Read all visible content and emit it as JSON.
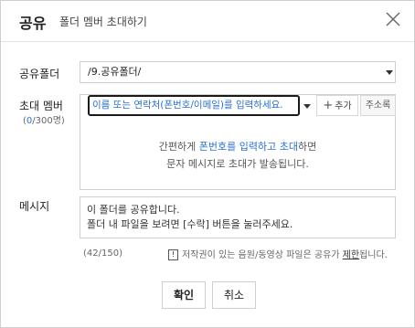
{
  "dialog": {
    "title": "공유",
    "subtitle": "폴더 멤버 초대하기",
    "close_icon": "close-icon"
  },
  "share_folder": {
    "label": "공유폴더",
    "value": "/9.공유폴더/"
  },
  "invite": {
    "label": "초대 멤버",
    "count_current": "0",
    "count_max": "/300명)",
    "count_open": "(",
    "input_placeholder": "이름 또는 연락처(폰번호/이메일)를 입력하세요.",
    "add_label": "추가",
    "address_book_label": "주소록",
    "hint_prefix": "간편하게 ",
    "hint_highlight": "폰번호를 입력하고 초대",
    "hint_suffix": "하면",
    "hint_line2": "문자 메시지로 초대가 발송됩니다."
  },
  "message": {
    "label": "메시지",
    "line1": "이 폴더를 공유합니다.",
    "line2": "폴더 내 파일을 보려면 [수락] 버튼을 눌러주세요.",
    "counter": "(42/150)"
  },
  "notice": {
    "icon_text": "!",
    "text_before": "저작권이 있는 음원/동영상 파일은 공유가 ",
    "link": "제한",
    "text_after": "됩니다."
  },
  "buttons": {
    "confirm": "확인",
    "cancel": "취소"
  }
}
